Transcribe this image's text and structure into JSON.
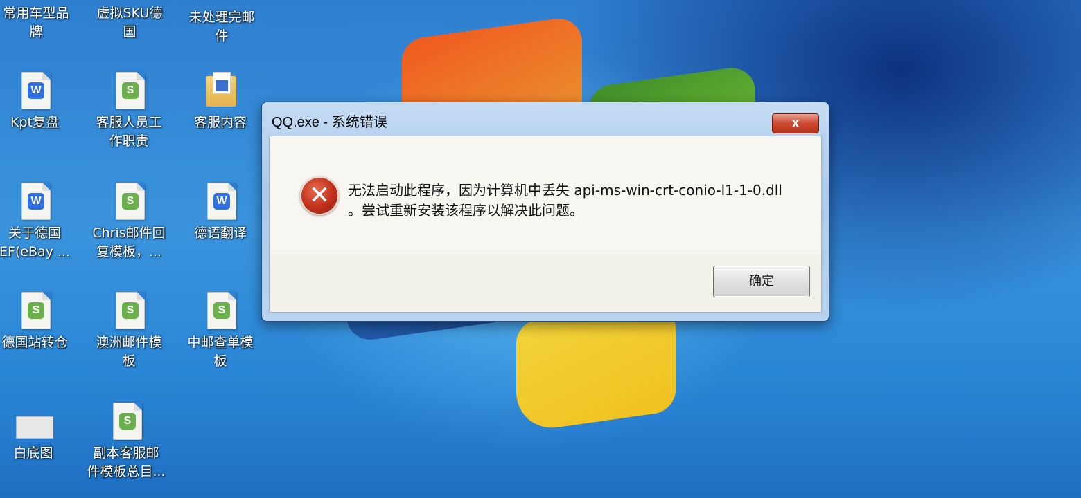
{
  "desktop": {
    "icons": [
      {
        "label1": "常用车型品",
        "label2": "牌",
        "type": "none"
      },
      {
        "label1": "虚拟SKU德",
        "label2": "国",
        "type": "none"
      },
      {
        "label1": "未处理完邮",
        "label2": "件",
        "type": "none"
      },
      {
        "label1": "Kpt复盘",
        "label2": "",
        "type": "word"
      },
      {
        "label1": "客服人员工",
        "label2": "作职责",
        "type": "sheet"
      },
      {
        "label1": "客服内容",
        "label2": "",
        "type": "folder"
      },
      {
        "label1": "关于德国",
        "label2": "EF(eBay ...",
        "type": "word"
      },
      {
        "label1": "Chris邮件回",
        "label2": "复模板，...",
        "type": "sheet"
      },
      {
        "label1": "德语翻译",
        "label2": "",
        "type": "word"
      },
      {
        "label1": "德国站转仓",
        "label2": "",
        "type": "sheet"
      },
      {
        "label1": "澳洲邮件模",
        "label2": "板",
        "type": "sheet"
      },
      {
        "label1": "中邮查单模",
        "label2": "板",
        "type": "sheet"
      },
      {
        "label1": "白底图",
        "label2": "",
        "type": "picture"
      },
      {
        "label1": "副本客服邮",
        "label2": "件模板总目...",
        "type": "sheet"
      }
    ],
    "icon_letters": {
      "word": "W",
      "sheet": "S"
    }
  },
  "dialog": {
    "title": "QQ.exe - 系统错误",
    "close_label": "x",
    "error_glyph": "✕",
    "message_line1": "无法启动此程序，因为计算机中丢失 api-ms-win-crt-conio-l1-1-0.dll",
    "message_line2": "。尝试重新安装该程序以解决此问题。",
    "ok_label": "确定"
  }
}
